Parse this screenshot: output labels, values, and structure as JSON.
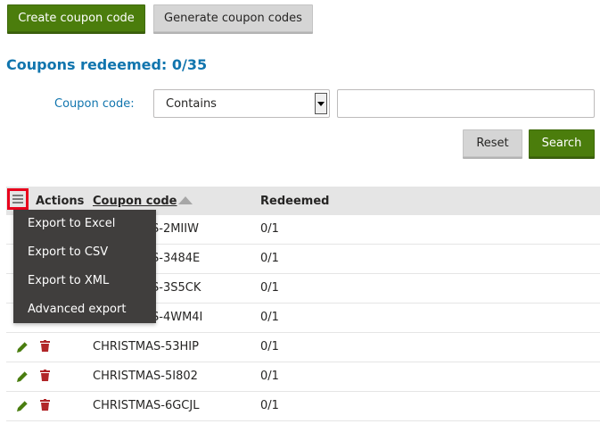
{
  "toolbar": {
    "create_label": "Create coupon code",
    "generate_label": "Generate coupon codes"
  },
  "heading": "Coupons redeemed: 0/35",
  "filter": {
    "label": "Coupon code:",
    "operator_selected": "Contains",
    "value": "",
    "reset_label": "Reset",
    "search_label": "Search"
  },
  "grid": {
    "columns": {
      "actions": "Actions",
      "coupon_code": "Coupon code",
      "redeemed": "Redeemed"
    },
    "sort": {
      "column": "coupon_code",
      "direction": "ascending"
    },
    "rows": [
      {
        "code_visible": "S-2MIIW",
        "redeemed": "0/1"
      },
      {
        "code_visible": "S-3484E",
        "redeemed": "0/1"
      },
      {
        "code_visible": "S-3S5CK",
        "redeemed": "0/1"
      },
      {
        "code_visible": "S-4WM4I",
        "redeemed": "0/1"
      },
      {
        "code": "CHRISTMAS-53HIP",
        "redeemed": "0/1"
      },
      {
        "code": "CHRISTMAS-5I802",
        "redeemed": "0/1"
      },
      {
        "code": "CHRISTMAS-6GCJL",
        "redeemed": "0/1"
      }
    ]
  },
  "export_menu": {
    "items": [
      "Export to Excel",
      "Export to CSV",
      "Export to XML",
      "Advanced export"
    ]
  },
  "colors": {
    "primary_green": "#4b7d0c",
    "heading_blue": "#1175ae",
    "edit_green": "#497d0f",
    "delete_red": "#b12628",
    "menu_bg": "#403e3d",
    "highlight_red": "#e8001c"
  },
  "icons": {
    "menu_toggle": "hamburger-icon",
    "edit": "pencil-icon",
    "delete": "trash-icon",
    "sort": "triangle-up-icon",
    "select_arrow": "caret-down-icon"
  }
}
